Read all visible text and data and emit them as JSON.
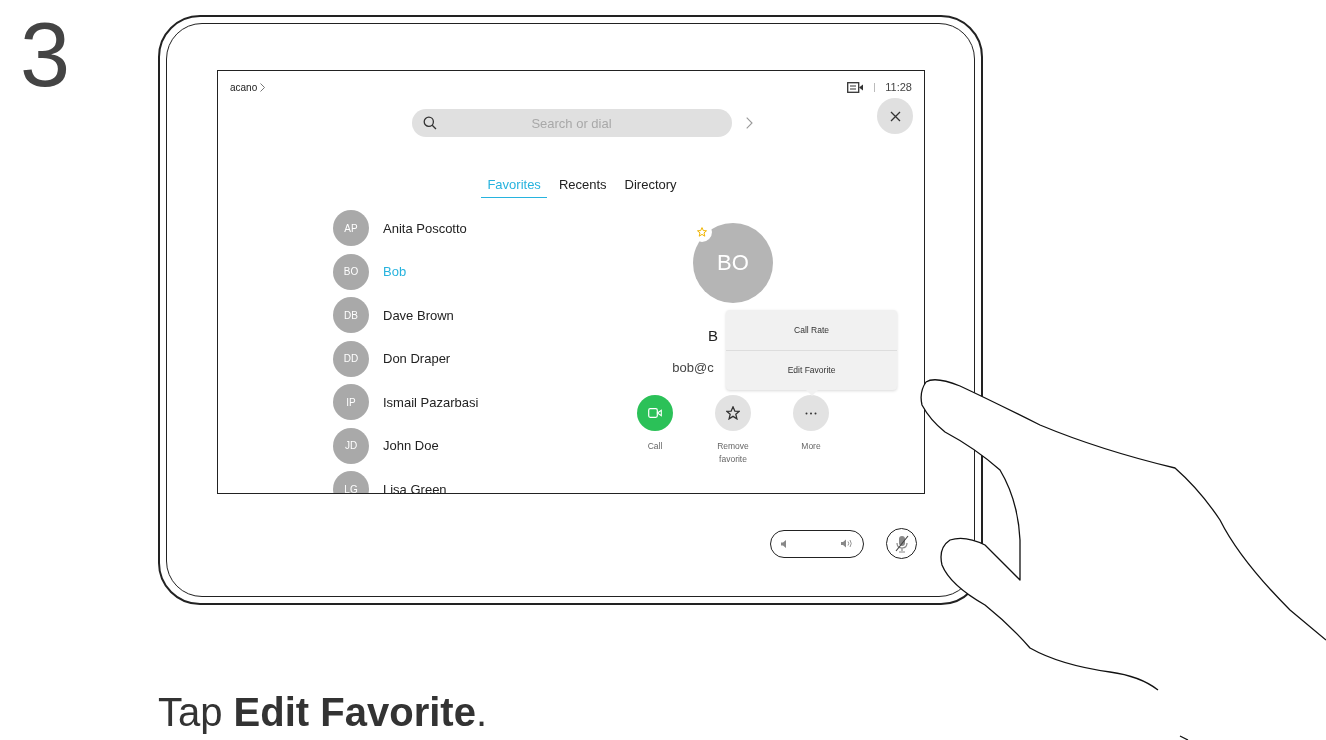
{
  "step_number": "3",
  "screen": {
    "header": {
      "brand": "acano",
      "time": "11:28"
    },
    "search": {
      "placeholder": "Search or dial"
    },
    "tabs": [
      {
        "label": "Favorites",
        "selected": true
      },
      {
        "label": "Recents",
        "selected": false
      },
      {
        "label": "Directory",
        "selected": false
      }
    ],
    "contacts": [
      {
        "initials": "AP",
        "name": "Anita Poscotto",
        "selected": false
      },
      {
        "initials": "BO",
        "name": "Bob",
        "selected": true
      },
      {
        "initials": "DB",
        "name": "Dave Brown",
        "selected": false
      },
      {
        "initials": "DD",
        "name": "Don Draper",
        "selected": false
      },
      {
        "initials": "IP",
        "name": "Ismail Pazarbasi",
        "selected": false
      },
      {
        "initials": "JD",
        "name": "John Doe",
        "selected": false
      },
      {
        "initials": "LG",
        "name": "Lisa Green",
        "selected": false
      }
    ],
    "detail": {
      "initials": "BO",
      "favorite": true,
      "name": "B",
      "address": "bob@c",
      "actions": [
        {
          "kind": "call",
          "label": "Call"
        },
        {
          "kind": "favorite",
          "label": "Remove favorite"
        },
        {
          "kind": "more",
          "label": "More"
        }
      ]
    },
    "menu": {
      "items": [
        "Call Rate",
        "Edit Favorite"
      ]
    }
  },
  "controls": {
    "mic_muted": true
  },
  "caption": "Tap **Edit Favorite**."
}
